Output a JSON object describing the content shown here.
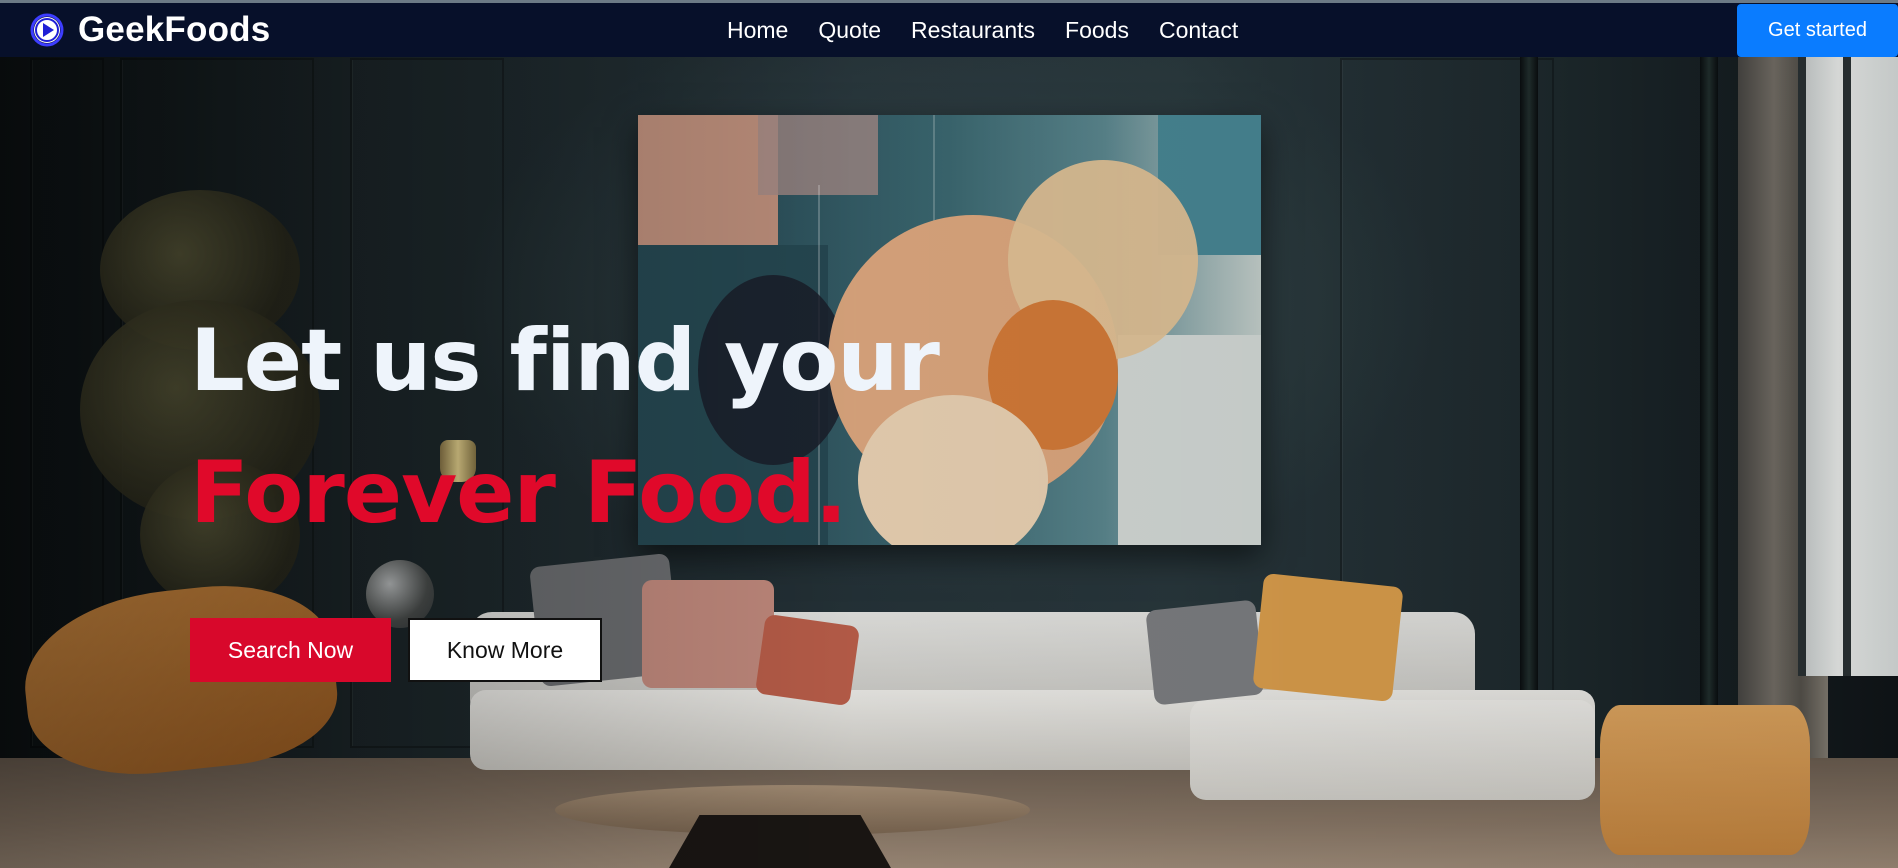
{
  "brand": {
    "name": "GeekFoods",
    "icon": "play-circle-icon"
  },
  "nav": {
    "links": [
      "Home",
      "Quote",
      "Restaurants",
      "Foods",
      "Contact"
    ],
    "cta_label": "Get started"
  },
  "hero": {
    "line1": "Let us find your",
    "line2": "Forever Food.",
    "primary_button": "Search Now",
    "secondary_button": "Know More"
  },
  "colors": {
    "nav_bg": "#07102a",
    "cta_blue": "#0a7cff",
    "accent_red": "#e0092a",
    "headline_white": "#eef4fb"
  }
}
